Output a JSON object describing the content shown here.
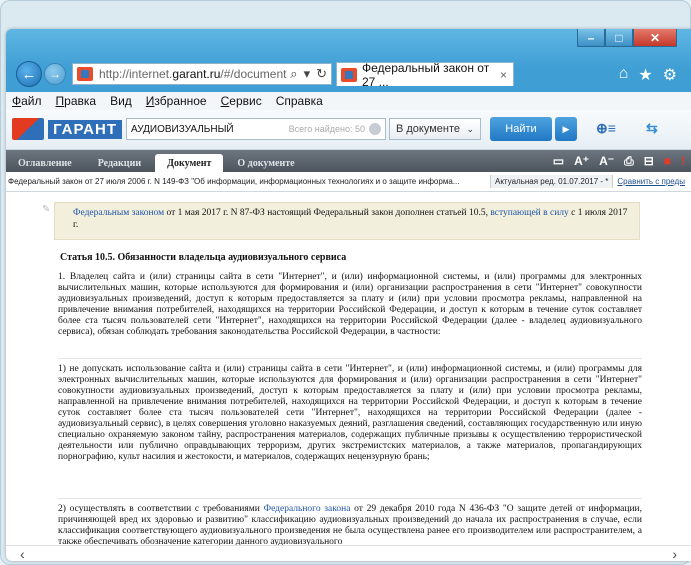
{
  "window": {
    "controls": {
      "minimize": "–",
      "maximize": "□",
      "close": "✕"
    }
  },
  "browser": {
    "back_icon": "←",
    "forward_icon": "→",
    "address_prefix": "http://internet.",
    "address_domain": "garant.ru",
    "address_suffix": "/#/document",
    "address_search_icon": "⌕",
    "address_dropdown_icon": "▾",
    "address_refresh_icon": "↻",
    "tab_title": "Федеральный закон от 27 ...",
    "tab_close": "×",
    "home_icon": "⌂",
    "favorites_icon": "★",
    "settings_icon": "⚙"
  },
  "menubar": {
    "items": [
      {
        "hotkey": "Ф",
        "rest": "айл"
      },
      {
        "hotkey": "П",
        "rest": "равка"
      },
      {
        "hotkey": "",
        "rest": "Вид"
      },
      {
        "hotkey": "И",
        "rest": "збранное"
      },
      {
        "hotkey": "С",
        "rest": "ервис"
      },
      {
        "hotkey": "",
        "rest": "Справка"
      }
    ]
  },
  "garant": {
    "logo_text": "ГАРАНТ",
    "search_query": "АУДИОВИЗУАЛЬНЫЙ",
    "found_text": "Всего найдено: 50",
    "scope_label": "В документе",
    "scope_chevron": "⌄",
    "find_label": "Найти",
    "next_icon": "▶",
    "tool_icon_1": "⊕≡",
    "tool_icon_2": "⇆"
  },
  "doc_tabs": {
    "tabs": [
      "Оглавление",
      "Редакции",
      "Документ",
      "О документе"
    ],
    "active": "Документ",
    "right_icons": {
      "a": "▭",
      "font_up": "A⁺",
      "font_down": "A⁻",
      "print": "⎙",
      "save": "⊟",
      "flag": "■",
      "alert": "!"
    }
  },
  "breadcrumb": {
    "title": "Федеральный закон от 27 июля 2006 г. N 149-ФЗ \"Об информации, информационных технологиях и о защите информа...",
    "edition": "Актуальная ред. 01.07.2017 - *",
    "compare": "Сравнить с преды"
  },
  "document": {
    "note_link1": "Федеральным законом",
    "note_text1": " от 1 мая 2017 г. N 87-ФЗ настоящий Федеральный закон дополнен статьей 10.5, ",
    "note_link2": "вступающей в силу",
    "note_text2": " с 1 июля 2017 г.",
    "article_title": "Статья 10.5. Обязанности владельца аудиовизуального сервиса",
    "p1": "1. Владелец сайта и (или) страницы сайта в сети \"Интернет\", и (или) информационной системы, и (или) программы для электронных вычислительных машин, которые используются для формирования и (или) организации распространения в сети \"Интернет\" совокупности аудиовизуальных произведений, доступ к которым предоставляется за плату и (или) при условии просмотра рекламы, направленной на привлечение внимания потребителей, находящихся на территории Российской Федерации, и доступ к которым в течение суток составляет более ста тысяч пользователей сети \"Интернет\", находящихся на территории Российской Федерации (далее - владелец аудиовизуального сервиса), обязан соблюдать требования законодательства Российской Федерации, в частности:",
    "p2": "1) не допускать использование сайта и (или) страницы сайта в сети \"Интернет\", и (или) информационной системы, и (или) программы для электронных вычислительных машин, которые используются для формирования и (или) организации распространения в сети \"Интернет\" совокупности аудиовизуальных произведений, доступ к которым предоставляется за плату и (или) при условии просмотра рекламы, направленной на привлечение внимания потребителей, находящихся на территории Российской Федерации, и доступ к которым в течение суток составляет более ста тысяч пользователей сети \"Интернет\", находящихся на территории Российской Федерации (далее - аудиовизуальный сервис), в целях совершения уголовно наказуемых деяний, разглашения сведений, составляющих государственную или иную специально охраняемую законом тайну, распространения материалов, содержащих публичные призывы к осуществлению террористической деятельности или публично оправдывающих терроризм, других экстремистских материалов, а также материалов, пропагандирующих порнографию, культ насилия и жестокости, и материалов, содержащих нецензурную брань;",
    "p3_a": "2) осуществлять в соответствии с требованиями ",
    "p3_link": "Федерального закона",
    "p3_b": " от 29 декабря 2010 года N 436-ФЗ \"О защите детей от информации, причиняющей вред их здоровью и развитию\" классификацию аудиовизуальных произведений до начала их распространения в случае, если классификация соответствующего аудиовизуального произведения не была осуществлена ранее его производителем или распространителем, а также обеспечивать обозначение категории данного аудиовизуального"
  },
  "scroll": {
    "left": "‹",
    "right": "›"
  }
}
